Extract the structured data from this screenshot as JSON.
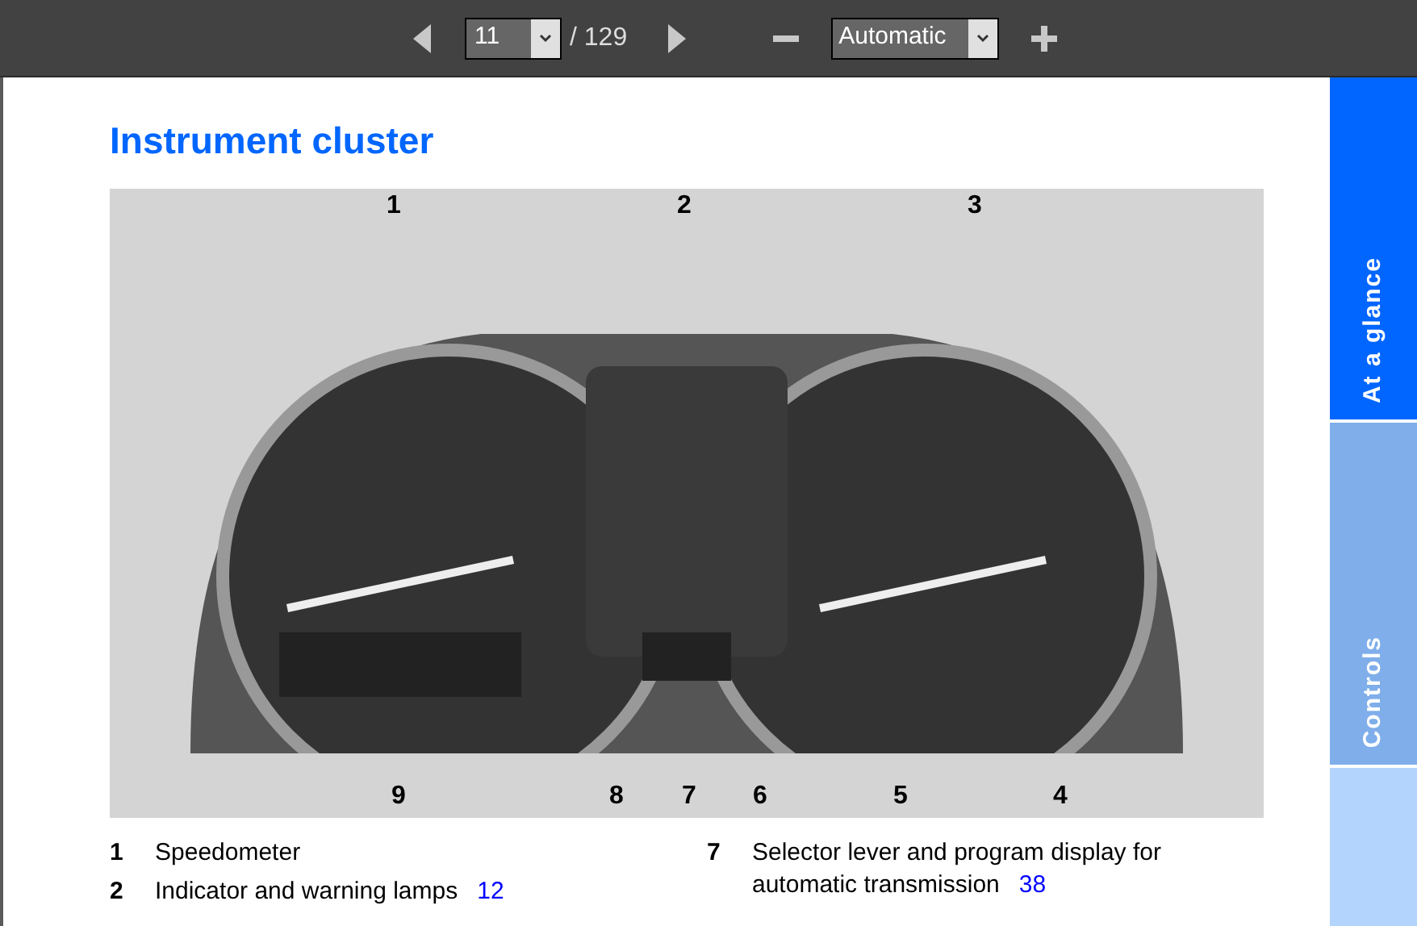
{
  "toolbar": {
    "page": "11",
    "page_count": "/ 129",
    "zoom": "Automatic"
  },
  "page": {
    "title": "Instrument cluster",
    "figure": {
      "top_callouts": [
        "1",
        "2",
        "3"
      ],
      "bottom_callouts": [
        "9",
        "8",
        "7",
        "6",
        "5",
        "4"
      ]
    },
    "legend": [
      [
        {
          "number": "1",
          "text": "Speedometer"
        },
        {
          "number": "2",
          "text": "Indicator and warning lamps",
          "page_link": "12"
        }
      ],
      [
        {
          "number": "7",
          "text": "Selector lever and program display for automatic transmission",
          "page_link": "38"
        }
      ]
    ]
  },
  "side_tabs": [
    {
      "label": "At a glance",
      "selected": true
    },
    {
      "label": "Controls",
      "selected": false
    }
  ]
}
